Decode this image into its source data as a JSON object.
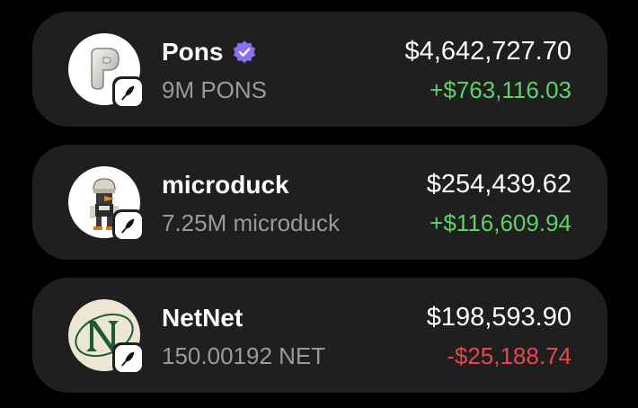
{
  "colors": {
    "background": "#000000",
    "card": "#1f1f1f",
    "positive": "#5fd16b",
    "negative": "#e5484d",
    "verified": "#8b6ff0"
  },
  "assets": [
    {
      "name": "Pons",
      "verified": true,
      "quantity": "9M PONS",
      "value": "$4,642,727.70",
      "change": "+$763,116.03",
      "change_direction": "positive",
      "avatar_icon": "pons-logo-icon",
      "chain_icon": "quill-icon"
    },
    {
      "name": "microduck",
      "verified": false,
      "quantity": "7.25M microduck",
      "value": "$254,439.62",
      "change": "+$116,609.94",
      "change_direction": "positive",
      "avatar_icon": "microduck-logo-icon",
      "chain_icon": "quill-icon"
    },
    {
      "name": "NetNet",
      "verified": false,
      "quantity": "150.00192 NET",
      "value": "$198,593.90",
      "change": "-$25,188.74",
      "change_direction": "negative",
      "avatar_icon": "netnet-logo-icon",
      "chain_icon": "quill-icon"
    }
  ]
}
